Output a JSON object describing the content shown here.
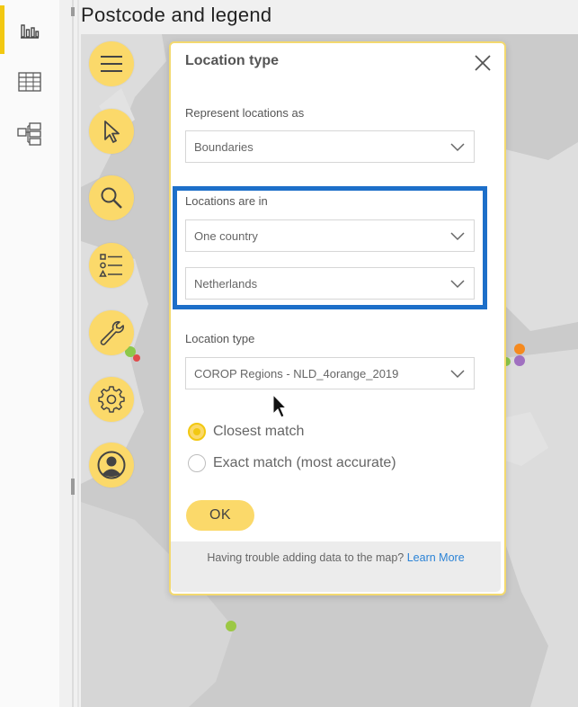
{
  "rail": {
    "items": [
      {
        "name": "report-view",
        "icon": "bar-chart-icon",
        "active": true
      },
      {
        "name": "data-view",
        "icon": "table-icon",
        "active": false
      },
      {
        "name": "model-view",
        "icon": "model-icon",
        "active": false
      }
    ]
  },
  "visual": {
    "title": "Postcode and legend"
  },
  "toolbar": {
    "buttons": [
      "menu-icon",
      "pointer-icon",
      "search-icon",
      "legend-icon",
      "wrench-icon",
      "gear-icon",
      "user-icon"
    ]
  },
  "dialog": {
    "title": "Location type",
    "represent_label": "Represent locations as",
    "represent_value": "Boundaries",
    "locations_label": "Locations are in",
    "scope_value": "One country",
    "country_value": "Netherlands",
    "location_type_label": "Location type",
    "location_type_value": "COROP Regions - NLD_4orange_2019",
    "match_options": [
      {
        "label": "Closest match",
        "selected": true
      },
      {
        "label": "Exact match (most accurate)",
        "selected": false
      }
    ],
    "ok_label": "OK",
    "footer_text": "Having trouble adding data to the map?",
    "footer_link": "Learn More"
  },
  "colors": {
    "accent_yellow": "#fbd96a",
    "highlight_blue": "#1d6fc9",
    "link_blue": "#2b83d6"
  }
}
